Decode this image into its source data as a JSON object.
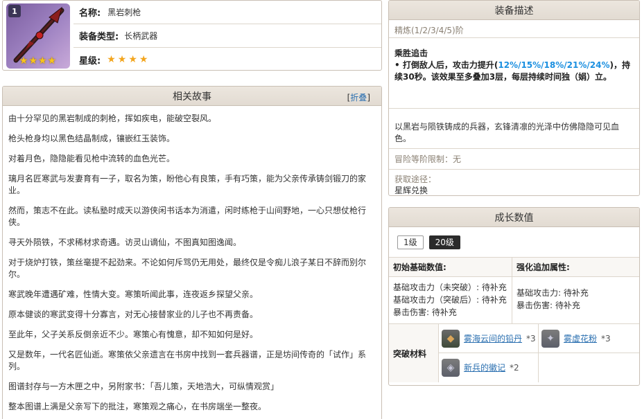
{
  "info": {
    "rarity_number": "1",
    "stars_display": "★★★★",
    "name_label": "名称:",
    "name_value": "黑岩刺枪",
    "type_label": "装备类型:",
    "type_value": "长柄武器",
    "star_label": "星级:",
    "star_count": 4,
    "star_glyph": "★"
  },
  "story": {
    "title": "相关故事",
    "fold_prefix": "[",
    "fold_label": "折叠",
    "fold_suffix": "]",
    "paragraphs": [
      "由十分罕见的黑岩制成的刺枪，挥如疾电，能破空裂风。",
      "枪头枪身均以黑色结晶制成，镶嵌红玉装饰。",
      "对着月色，隐隐能看见枪中流转的血色光芒。",
      "璃月名匠寒武与发妻育有一子，取名为策，盼他心有良策，手有巧策，能为父亲传承铸剑锻刀的家业。",
      "然而，策志不在此。读私塾时成天以游侠闲书话本为消遣，闲时练枪于山间野地，一心只想仗枪行侠。",
      "寻天外陨铁，不求稀材求奇遇。访灵山谪仙，不图真知图逸闻。",
      "对于烧炉打铁，策丝毫提不起劲来。不论如何斥骂仍无用处，最终仅是令痴儿浪子某日不辞而别尔尔。",
      "寒武晚年遭遇矿难，性情大变。寒策听闻此事，连夜返乡探望父亲。",
      "原本健谈的寒武变得十分寡言，对无心接替家业的儿子也不再责备。",
      "至此年，父子关系反倒亲近不少。寒策心有愧意，却不知如何是好。",
      "又是数年，一代名匠仙逝。寒策依父亲遗言在书房中找到一套兵器谱，正是坊间传奇的「试作」系列。",
      "图谱封存与一方木匣之中，另附家书：「吾儿策，天地浩大，可纵情观赏」",
      "整本图谱上满是父亲写下的批注，寒策观之痛心，在书房端坐一整夜。"
    ]
  },
  "desc": {
    "title": "装备描述",
    "refine": "精炼(1/2/3/4/5)阶",
    "effect_title": "乘胜追击",
    "effect_pre": "• 打倒敌人后，攻击力提升(",
    "effect_values": "12%/15%/18%/21%/24%",
    "effect_post": ")，持续30秒。该效果至多叠加3层，每层持续时间独（娟）立。",
    "flavor": "以黑岩与陨铁铸成的兵器，玄锋清凛的光泽中仿佛隐隐可见血色。",
    "limit": "冒险等阶限制：无",
    "obtain_label": "获取途径：",
    "obtain_value": "星辉兑换"
  },
  "growth": {
    "title": "成长数值",
    "levels": [
      "1级",
      "20级"
    ],
    "active_level": "20级",
    "base_head": "初始基础数值:",
    "bonus_head": "强化追加属性:",
    "base_lines": [
      "基础攻击力（未突破）: 待补充",
      "基础攻击力（突破后）: 待补充",
      "暴击伤害: 待补充"
    ],
    "bonus_lines": [
      "基础攻击力: 待补充",
      "暴击伤害: 待补充"
    ],
    "materials_label": "突破材料",
    "materials": [
      {
        "name": "雾海云间的铅丹",
        "qty": "*3",
        "icon": "lead-pill-icon"
      },
      {
        "name": "雾虚花粉",
        "qty": "*3",
        "icon": "mist-pollen-icon"
      },
      {
        "name": "新兵的徽记",
        "qty": "*2",
        "icon": "recruit-insignia-icon"
      }
    ]
  }
}
